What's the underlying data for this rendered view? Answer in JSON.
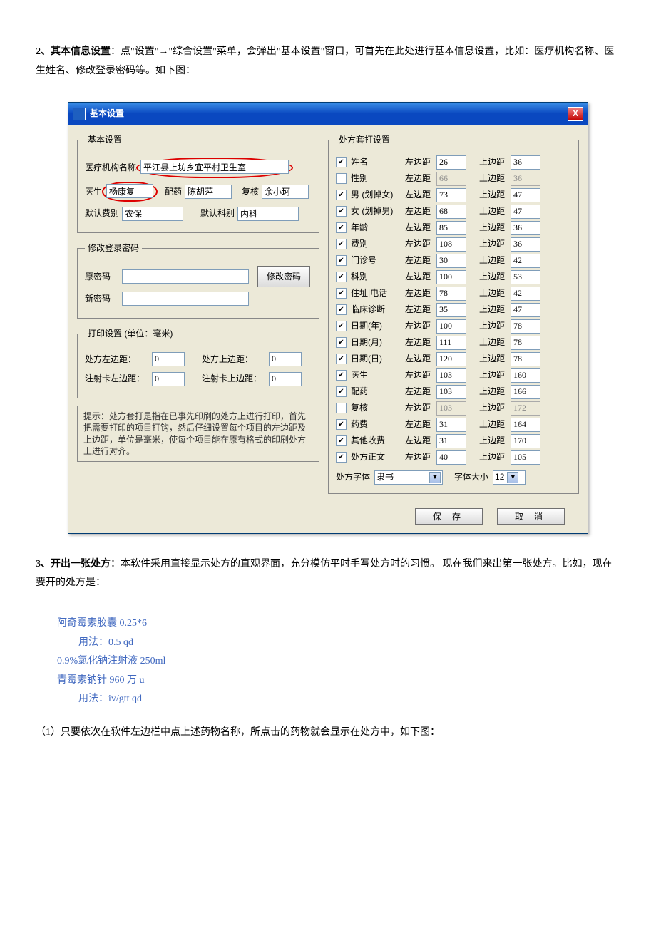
{
  "doc": {
    "section2_title": "2、其本信息设置",
    "section2_text": "：点\"设置\"→\"综合设置\"菜单，会弹出\"基本设置\"窗口，可首先在此处进行基本信息设置，比如：医疗机构名称、医生姓名、修改登录密码等。如下图：",
    "section3_title": "3、开出一张处方",
    "section3_text": "：本软件采用直接显示处方的直观界面，充分模仿平时手写处方时的习惯。 现在我们来出第一张处方。比如，现在要开的处方是：",
    "rx": {
      "l1": "阿奇霉素胶囊 0.25*6",
      "l2": "用法：0.5 qd",
      "l3": "0.9%氯化钠注射液 250ml",
      "l4": "青霉素钠针 960 万 u",
      "l5": "用法：iv/gtt qd"
    },
    "section3_note": "（1）只要依次在软件左边栏中点上述药物名称，所点击的药物就会显示在处方中，如下图："
  },
  "win": {
    "title": "基本设置",
    "close": "X",
    "basic": {
      "legend": "基本设置",
      "org_label": "医疗机构名称",
      "org_value": "平江县上坊乡宜平村卫生室",
      "doctor_label": "医生",
      "doctor_value": "杨康复",
      "dispense_label": "配药",
      "dispense_value": "陈胡萍",
      "review_label": "复核",
      "review_value": "余小珂",
      "fee_label": "默认费别",
      "fee_value": "农保",
      "dept_label": "默认科别",
      "dept_value": "内科"
    },
    "pwd": {
      "legend": "修改登录密码",
      "old_label": "原密码",
      "new_label": "新密码",
      "btn": "修改密码"
    },
    "printset": {
      "legend": "打印设置 (单位：毫米)",
      "rx_left_label": "处方左边距：",
      "rx_left_value": "0",
      "rx_top_label": "处方上边距：",
      "rx_top_value": "0",
      "card_left_label": "注射卡左边距：",
      "card_left_value": "0",
      "card_top_label": "注射卡上边距：",
      "card_top_value": "0"
    },
    "hint": "提示：处方套打是指在已事先印刷的处方上进行打印，首先把需要打印的项目打钩，然后仔细设置每个项目的左边距及上边距，单位是毫米，使每个项目能在原有格式的印刷处方上进行对齐。",
    "overlay": {
      "legend": "处方套打设置",
      "left_label": "左边距",
      "top_label": "上边距",
      "rows": [
        {
          "checked": true,
          "label": "姓名",
          "left": "26",
          "top": "36",
          "enabled": true
        },
        {
          "checked": false,
          "label": "性别",
          "left": "66",
          "top": "36",
          "enabled": false
        },
        {
          "checked": true,
          "label": "男 (划掉女)",
          "left": "73",
          "top": "47",
          "enabled": true
        },
        {
          "checked": true,
          "label": "女 (划掉男)",
          "left": "68",
          "top": "47",
          "enabled": true
        },
        {
          "checked": true,
          "label": "年龄",
          "left": "85",
          "top": "36",
          "enabled": true
        },
        {
          "checked": true,
          "label": "费别",
          "left": "108",
          "top": "36",
          "enabled": true
        },
        {
          "checked": true,
          "label": "门诊号",
          "left": "30",
          "top": "42",
          "enabled": true
        },
        {
          "checked": true,
          "label": "科别",
          "left": "100",
          "top": "53",
          "enabled": true
        },
        {
          "checked": true,
          "label": "住址|电话",
          "left": "78",
          "top": "42",
          "enabled": true
        },
        {
          "checked": true,
          "label": "临床诊断",
          "left": "35",
          "top": "47",
          "enabled": true
        },
        {
          "checked": true,
          "label": "日期(年)",
          "left": "100",
          "top": "78",
          "enabled": true
        },
        {
          "checked": true,
          "label": "日期(月)",
          "left": "111",
          "top": "78",
          "enabled": true
        },
        {
          "checked": true,
          "label": "日期(日)",
          "left": "120",
          "top": "78",
          "enabled": true
        },
        {
          "checked": true,
          "label": "医生",
          "left": "103",
          "top": "160",
          "enabled": true
        },
        {
          "checked": true,
          "label": "配药",
          "left": "103",
          "top": "166",
          "enabled": true
        },
        {
          "checked": false,
          "label": "复核",
          "left": "103",
          "top": "172",
          "enabled": false
        },
        {
          "checked": true,
          "label": "药费",
          "left": "31",
          "top": "164",
          "enabled": true
        },
        {
          "checked": true,
          "label": "其他收费",
          "left": "31",
          "top": "170",
          "enabled": true
        },
        {
          "checked": true,
          "label": "处方正文",
          "left": "40",
          "top": "105",
          "enabled": true
        }
      ],
      "font_label": "处方字体",
      "font_value": "隶书",
      "size_label": "字体大小",
      "size_value": "12"
    },
    "save_btn": "保 存",
    "cancel_btn": "取 消"
  }
}
